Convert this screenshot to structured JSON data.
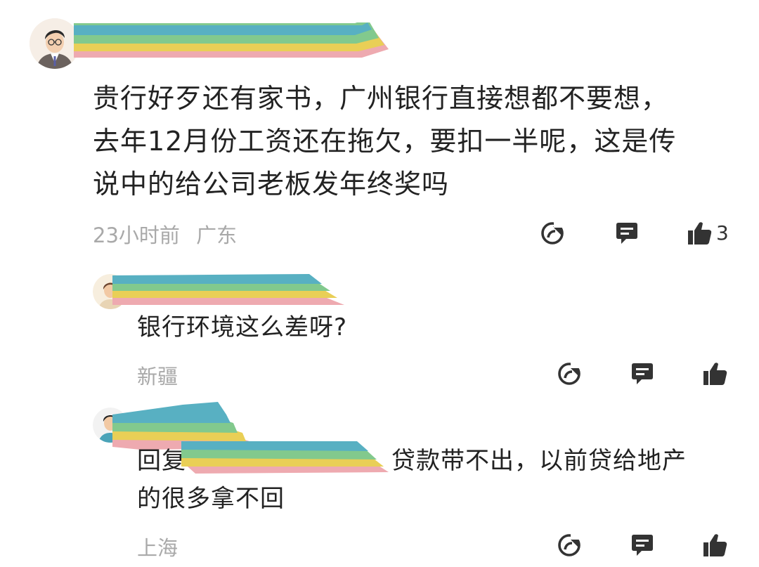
{
  "comment": {
    "text_lines": [
      "贵行好歹还有家书，广州银行直接想都不要想，",
      "去年12月份工资还在拖欠，要扣一半呢，这是传",
      "说中的给公司老板发年终奖吗"
    ],
    "time": "23小时前",
    "location": "广东",
    "like_count": "3"
  },
  "replies": [
    {
      "text": "银行环境这么差呀?",
      "location": "新疆"
    },
    {
      "prefix": "回复",
      "text_line1": "贷款带不出，以前贷给地产",
      "text_line2": "的很多拿不回",
      "location": "上海"
    }
  ],
  "icons": {
    "share": "share-icon",
    "reply": "comment-icon",
    "like": "thumbs-up-icon"
  },
  "colors": {
    "stripe_teal": "#58b0c2",
    "stripe_green": "#82c98d",
    "stripe_yellow": "#e9cf56",
    "stripe_pink": "#eeaab0",
    "meta_gray": "#a9a9a9",
    "icon_dark": "#333333"
  }
}
